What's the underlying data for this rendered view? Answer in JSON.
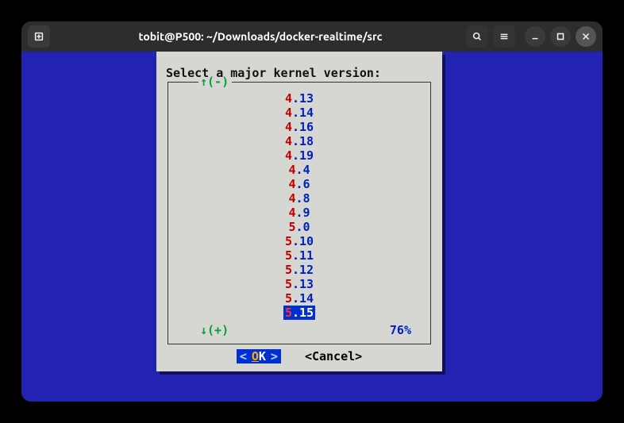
{
  "window": {
    "title": "tobit@P500: ~/Downloads/docker-realtime/src"
  },
  "dialog": {
    "prompt": "Select a major kernel version:",
    "scroll_up": "↑(-)",
    "scroll_down": "↓(+)",
    "percent": "76%",
    "ok_label": "OK",
    "cancel_label": "<Cancel>"
  },
  "kernels": [
    {
      "major": "4",
      "minor": "13",
      "selected": false
    },
    {
      "major": "4",
      "minor": "14",
      "selected": false
    },
    {
      "major": "4",
      "minor": "16",
      "selected": false
    },
    {
      "major": "4",
      "minor": "18",
      "selected": false
    },
    {
      "major": "4",
      "minor": "19",
      "selected": false
    },
    {
      "major": "4",
      "minor": "4",
      "selected": false
    },
    {
      "major": "4",
      "minor": "6",
      "selected": false
    },
    {
      "major": "4",
      "minor": "8",
      "selected": false
    },
    {
      "major": "4",
      "minor": "9",
      "selected": false
    },
    {
      "major": "5",
      "minor": "0",
      "selected": false
    },
    {
      "major": "5",
      "minor": "10",
      "selected": false
    },
    {
      "major": "5",
      "minor": "11",
      "selected": false
    },
    {
      "major": "5",
      "minor": "12",
      "selected": false
    },
    {
      "major": "5",
      "minor": "13",
      "selected": false
    },
    {
      "major": "5",
      "minor": "14",
      "selected": false
    },
    {
      "major": "5",
      "minor": "15",
      "selected": true
    }
  ]
}
